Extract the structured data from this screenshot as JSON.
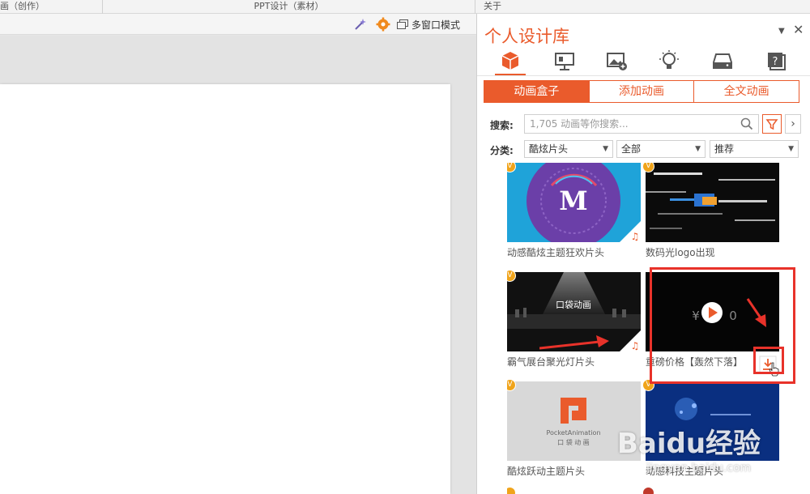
{
  "groups": [
    "画（创作）",
    "PPT设计（素材）",
    "关于"
  ],
  "toolbar": {
    "multi_window_label": "多窗口模式"
  },
  "panel": {
    "title": "个人设计库",
    "pin_glyph": "▼",
    "close_glyph": "✕",
    "icon_tabs": [
      "box-icon",
      "presentation-icon",
      "image-icon",
      "lightbulb-icon",
      "drive-icon",
      "help-icon"
    ],
    "tabs": [
      {
        "label": "动画盒子",
        "active": true
      },
      {
        "label": "添加动画",
        "active": false
      },
      {
        "label": "全文动画",
        "active": false
      }
    ],
    "search": {
      "label": "搜索:",
      "placeholder": "1,705 动画等你搜索..."
    },
    "category": {
      "label": "分类:",
      "selects": [
        "酷炫片头",
        "全部",
        "推荐"
      ]
    },
    "next_glyph": "›"
  },
  "cards": [
    {
      "caption": "动感酷炫主题狂欢片头",
      "thumb_text": "M",
      "badge": "V"
    },
    {
      "caption": "数码光logo出现",
      "thumb_text": "",
      "badge": "V"
    },
    {
      "caption": "霸气展台聚光灯片头",
      "thumb_text": "口袋动画",
      "badge": "V"
    },
    {
      "caption": "重磅价格【轰然下落】",
      "thumb_text": "¥",
      "thumb_text2": "0",
      "badge": ""
    },
    {
      "caption": "酷炫跃动主题片头",
      "thumb_text": "PocketAnimation",
      "thumb_text2": "口 袋 动 画",
      "badge": "V"
    },
    {
      "caption": "动感科技主题片头",
      "thumb_text": "",
      "badge": "V"
    }
  ],
  "watermark": {
    "main": "Baidu经验",
    "sub": "jingyan.baidu.com"
  },
  "colors": {
    "accent": "#ea5b2c",
    "annotation": "#e8322a",
    "badge": "#f0a41b"
  }
}
